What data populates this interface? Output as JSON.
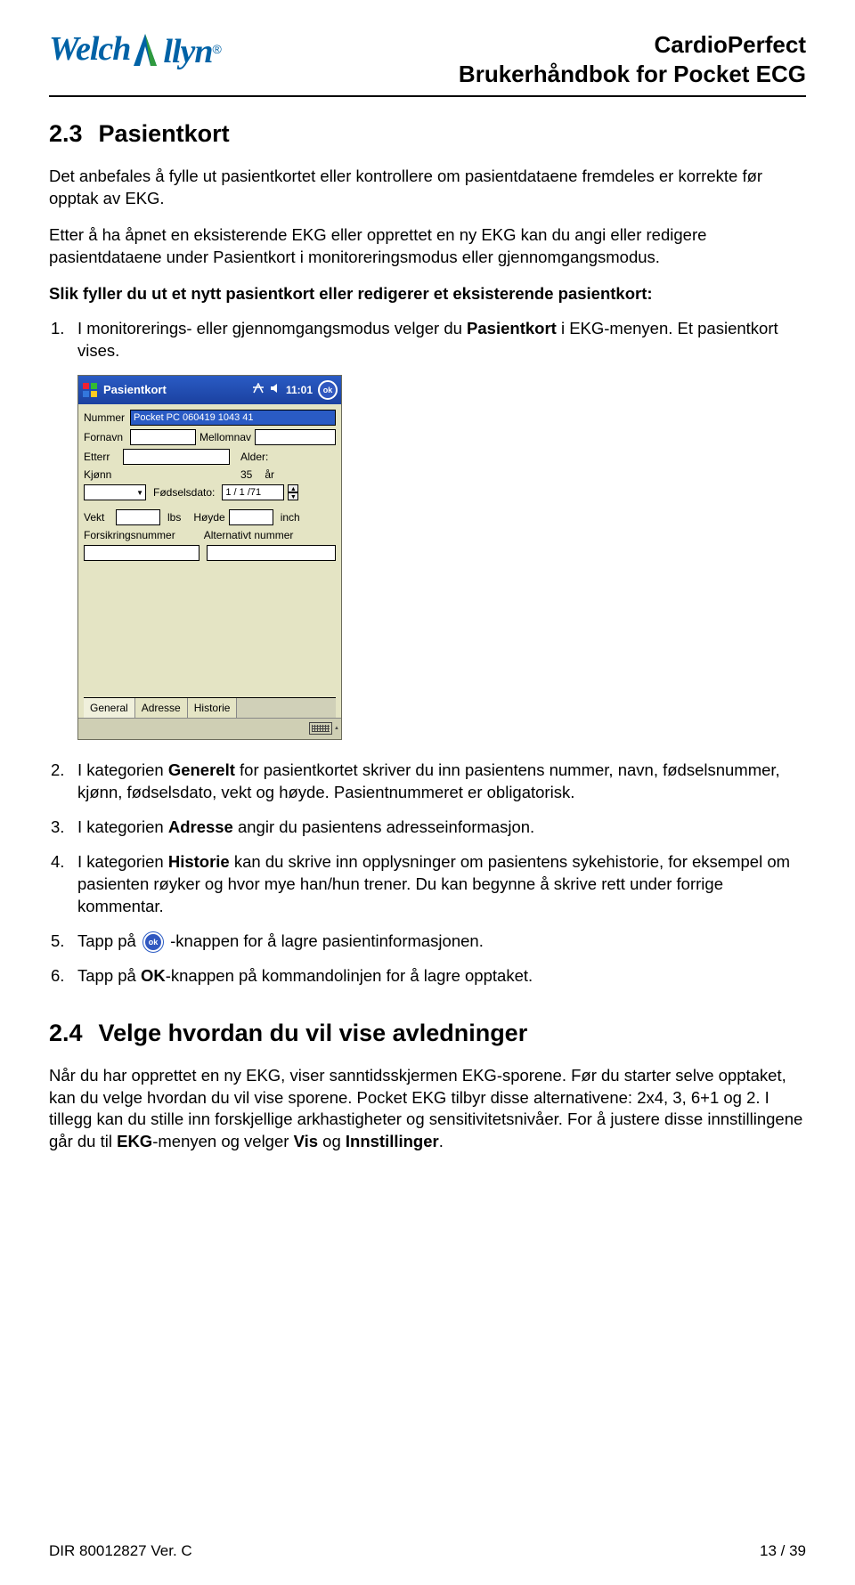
{
  "header": {
    "logo_text1": "Welch",
    "logo_text2": "llyn",
    "logo_reg": "®",
    "title_line1": "CardioPerfect",
    "title_line2": "Brukerhåndbok for Pocket ECG"
  },
  "section23": {
    "num": "2.3",
    "title": "Pasientkort",
    "para1": "Det anbefales å fylle ut pasientkortet eller kontrollere om pasientdataene fremdeles er korrekte før opptak av EKG.",
    "para2": "Etter å ha åpnet en eksisterende EKG eller opprettet en ny EKG kan du angi eller redigere pasientdataene under Pasientkort i monitoreringsmodus eller gjennomgangsmodus.",
    "boldline": "Slik fyller du ut et nytt pasientkort eller redigerer et eksisterende pasientkort:",
    "step1_a": "I monitorerings- eller gjennomgangsmodus velger du ",
    "step1_b": "Pasientkort",
    "step1_c": " i EKG-menyen. Et pasientkort vises.",
    "step2_a": "I kategorien ",
    "step2_b": "Generelt",
    "step2_c": " for pasientkortet skriver du inn pasientens nummer, navn, fødselsnummer, kjønn, fødselsdato, vekt og høyde. Pasientnummeret er obligatorisk.",
    "step3_a": "I kategorien ",
    "step3_b": "Adresse",
    "step3_c": " angir du pasientens adresseinformasjon.",
    "step4_a": "I kategorien ",
    "step4_b": "Historie",
    "step4_c": " kan du skrive inn opplysninger om pasientens sykehistorie, for eksempel om pasienten røyker og hvor mye han/hun trener. Du kan begynne å skrive rett under forrige kommentar.",
    "step5_a": "Tapp på ",
    "step5_b": " -knappen for å lagre pasientinformasjonen.",
    "step6_a": "Tapp på ",
    "step6_b": "OK",
    "step6_c": "-knappen på kommandolinjen for å lagre opptaket."
  },
  "ppc": {
    "title": "Pasientkort",
    "time": "11:01",
    "ok": "ok",
    "lbl_nummer": "Nummer",
    "val_nummer": "Pocket PC 060419 1043 41",
    "lbl_fornavn": "Fornavn",
    "lbl_mellomnavn": "Mellomnav",
    "lbl_etternavn": "Etterr",
    "lbl_alder": "Alder:",
    "lbl_kjonn": "Kjønn",
    "val_alder": "35",
    "unit_alder": "år",
    "lbl_fodselsdato": "Fødselsdato:",
    "val_fodselsdato": "1 / 1 /71",
    "lbl_vekt": "Vekt",
    "unit_vekt": "lbs",
    "lbl_hoyde": "Høyde",
    "unit_hoyde": "inch",
    "lbl_forsikring": "Forsikringsnummer",
    "lbl_altnummer": "Alternativt nummer",
    "tab_general": "General",
    "tab_adresse": "Adresse",
    "tab_historie": "Historie"
  },
  "section24": {
    "num": "2.4",
    "title": "Velge hvordan du vil vise avledninger",
    "para_a": "Når du har opprettet en ny EKG, viser sanntidsskjermen EKG-sporene. Før du starter selve opptaket, kan du velge hvordan du vil vise sporene. Pocket EKG tilbyr disse alternativene: 2x4, 3, 6+1 og 2. I tillegg kan du stille inn forskjellige arkhastigheter og sensitivitetsnivåer. For å justere disse innstillingene går du til ",
    "para_b": "EKG",
    "para_c": "-menyen og velger ",
    "para_d": "Vis",
    "para_e": " og ",
    "para_f": "Innstillinger",
    "para_g": "."
  },
  "footer": {
    "left": "DIR 80012827 Ver. C",
    "right": "13 / 39"
  }
}
